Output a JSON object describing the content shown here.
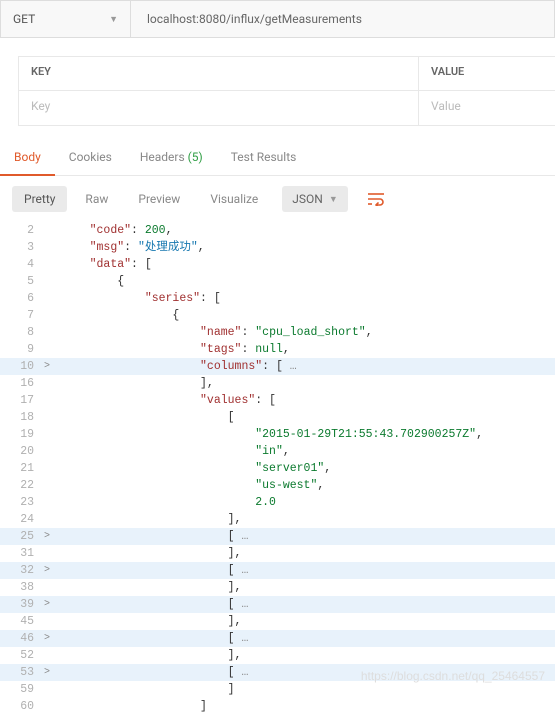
{
  "url_bar": {
    "method": "GET",
    "url": "localhost:8080/influx/getMeasurements"
  },
  "params": {
    "header_key": "KEY",
    "header_value": "VALUE",
    "placeholder_key": "Key",
    "placeholder_value": "Value"
  },
  "resp_tabs": {
    "body": "Body",
    "cookies": "Cookies",
    "headers": "Headers",
    "headers_count": "(5)",
    "tests": "Test Results"
  },
  "view_tabs": {
    "pretty": "Pretty",
    "raw": "Raw",
    "preview": "Preview",
    "visualize": "Visualize",
    "format": "JSON"
  },
  "code_rows": [
    {
      "n": 2,
      "fold": "",
      "hl": false,
      "tokens": [
        "    ",
        {
          "c": "k-key",
          "t": "\"code\""
        },
        {
          "c": "k-br",
          "t": ": "
        },
        {
          "c": "k-num",
          "t": "200"
        },
        {
          "c": "k-br",
          "t": ","
        }
      ]
    },
    {
      "n": 3,
      "fold": "",
      "hl": false,
      "tokens": [
        "    ",
        {
          "c": "k-key",
          "t": "\"msg\""
        },
        {
          "c": "k-br",
          "t": ": "
        },
        {
          "c": "k-cn",
          "t": "\"处理成功\""
        },
        {
          "c": "k-br",
          "t": ","
        }
      ]
    },
    {
      "n": 4,
      "fold": "",
      "hl": false,
      "tokens": [
        "    ",
        {
          "c": "k-key",
          "t": "\"data\""
        },
        {
          "c": "k-br",
          "t": ": ["
        }
      ]
    },
    {
      "n": 5,
      "fold": "",
      "hl": false,
      "tokens": [
        "        ",
        {
          "c": "k-br",
          "t": "{"
        }
      ]
    },
    {
      "n": 6,
      "fold": "",
      "hl": false,
      "tokens": [
        "            ",
        {
          "c": "k-key",
          "t": "\"series\""
        },
        {
          "c": "k-br",
          "t": ": ["
        }
      ]
    },
    {
      "n": 7,
      "fold": "",
      "hl": false,
      "tokens": [
        "                ",
        {
          "c": "k-br",
          "t": "{"
        }
      ]
    },
    {
      "n": 8,
      "fold": "",
      "hl": false,
      "tokens": [
        "                    ",
        {
          "c": "k-key",
          "t": "\"name\""
        },
        {
          "c": "k-br",
          "t": ": "
        },
        {
          "c": "k-str",
          "t": "\"cpu_load_short\""
        },
        {
          "c": "k-br",
          "t": ","
        }
      ]
    },
    {
      "n": 9,
      "fold": "",
      "hl": false,
      "tokens": [
        "                    ",
        {
          "c": "k-key",
          "t": "\"tags\""
        },
        {
          "c": "k-br",
          "t": ": "
        },
        {
          "c": "k-num",
          "t": "null"
        },
        {
          "c": "k-br",
          "t": ","
        }
      ]
    },
    {
      "n": 10,
      "fold": ">",
      "hl": true,
      "tokens": [
        "                    ",
        {
          "c": "k-key",
          "t": "\"columns\""
        },
        {
          "c": "k-br",
          "t": ": [ "
        },
        {
          "c": "k-dots",
          "t": "…"
        }
      ]
    },
    {
      "n": 16,
      "fold": "",
      "hl": false,
      "tokens": [
        "                    ",
        {
          "c": "k-br",
          "t": "],"
        }
      ]
    },
    {
      "n": 17,
      "fold": "",
      "hl": false,
      "tokens": [
        "                    ",
        {
          "c": "k-key",
          "t": "\"values\""
        },
        {
          "c": "k-br",
          "t": ": ["
        }
      ]
    },
    {
      "n": 18,
      "fold": "",
      "hl": false,
      "tokens": [
        "                        ",
        {
          "c": "k-br",
          "t": "["
        }
      ]
    },
    {
      "n": 19,
      "fold": "",
      "hl": false,
      "tokens": [
        "                            ",
        {
          "c": "k-str",
          "t": "\"2015-01-29T21:55:43.702900257Z\""
        },
        {
          "c": "k-br",
          "t": ","
        }
      ]
    },
    {
      "n": 20,
      "fold": "",
      "hl": false,
      "tokens": [
        "                            ",
        {
          "c": "k-str",
          "t": "\"in\""
        },
        {
          "c": "k-br",
          "t": ","
        }
      ]
    },
    {
      "n": 21,
      "fold": "",
      "hl": false,
      "tokens": [
        "                            ",
        {
          "c": "k-str",
          "t": "\"server01\""
        },
        {
          "c": "k-br",
          "t": ","
        }
      ]
    },
    {
      "n": 22,
      "fold": "",
      "hl": false,
      "tokens": [
        "                            ",
        {
          "c": "k-str",
          "t": "\"us-west\""
        },
        {
          "c": "k-br",
          "t": ","
        }
      ]
    },
    {
      "n": 23,
      "fold": "",
      "hl": false,
      "tokens": [
        "                            ",
        {
          "c": "k-num",
          "t": "2.0"
        }
      ]
    },
    {
      "n": 24,
      "fold": "",
      "hl": false,
      "tokens": [
        "                        ",
        {
          "c": "k-br",
          "t": "],"
        }
      ]
    },
    {
      "n": 25,
      "fold": ">",
      "hl": true,
      "tokens": [
        "                        ",
        {
          "c": "k-br",
          "t": "[ "
        },
        {
          "c": "k-dots",
          "t": "…"
        }
      ]
    },
    {
      "n": 31,
      "fold": "",
      "hl": false,
      "tokens": [
        "                        ",
        {
          "c": "k-br",
          "t": "],"
        }
      ]
    },
    {
      "n": 32,
      "fold": ">",
      "hl": true,
      "tokens": [
        "                        ",
        {
          "c": "k-br",
          "t": "[ "
        },
        {
          "c": "k-dots",
          "t": "…"
        }
      ]
    },
    {
      "n": 38,
      "fold": "",
      "hl": false,
      "tokens": [
        "                        ",
        {
          "c": "k-br",
          "t": "],"
        }
      ]
    },
    {
      "n": 39,
      "fold": ">",
      "hl": true,
      "tokens": [
        "                        ",
        {
          "c": "k-br",
          "t": "[ "
        },
        {
          "c": "k-dots",
          "t": "…"
        }
      ]
    },
    {
      "n": 45,
      "fold": "",
      "hl": false,
      "tokens": [
        "                        ",
        {
          "c": "k-br",
          "t": "],"
        }
      ]
    },
    {
      "n": 46,
      "fold": ">",
      "hl": true,
      "tokens": [
        "                        ",
        {
          "c": "k-br",
          "t": "[ "
        },
        {
          "c": "k-dots",
          "t": "…"
        }
      ]
    },
    {
      "n": 52,
      "fold": "",
      "hl": false,
      "tokens": [
        "                        ",
        {
          "c": "k-br",
          "t": "],"
        }
      ]
    },
    {
      "n": 53,
      "fold": ">",
      "hl": true,
      "tokens": [
        "                        ",
        {
          "c": "k-br",
          "t": "[ "
        },
        {
          "c": "k-dots",
          "t": "…"
        }
      ]
    },
    {
      "n": 59,
      "fold": "",
      "hl": false,
      "tokens": [
        "                        ",
        {
          "c": "k-br",
          "t": "]"
        }
      ]
    },
    {
      "n": 60,
      "fold": "",
      "hl": false,
      "tokens": [
        "                    ",
        {
          "c": "k-br",
          "t": "]"
        }
      ]
    }
  ],
  "watermark": "https://blog.csdn.net/qq_25464557"
}
